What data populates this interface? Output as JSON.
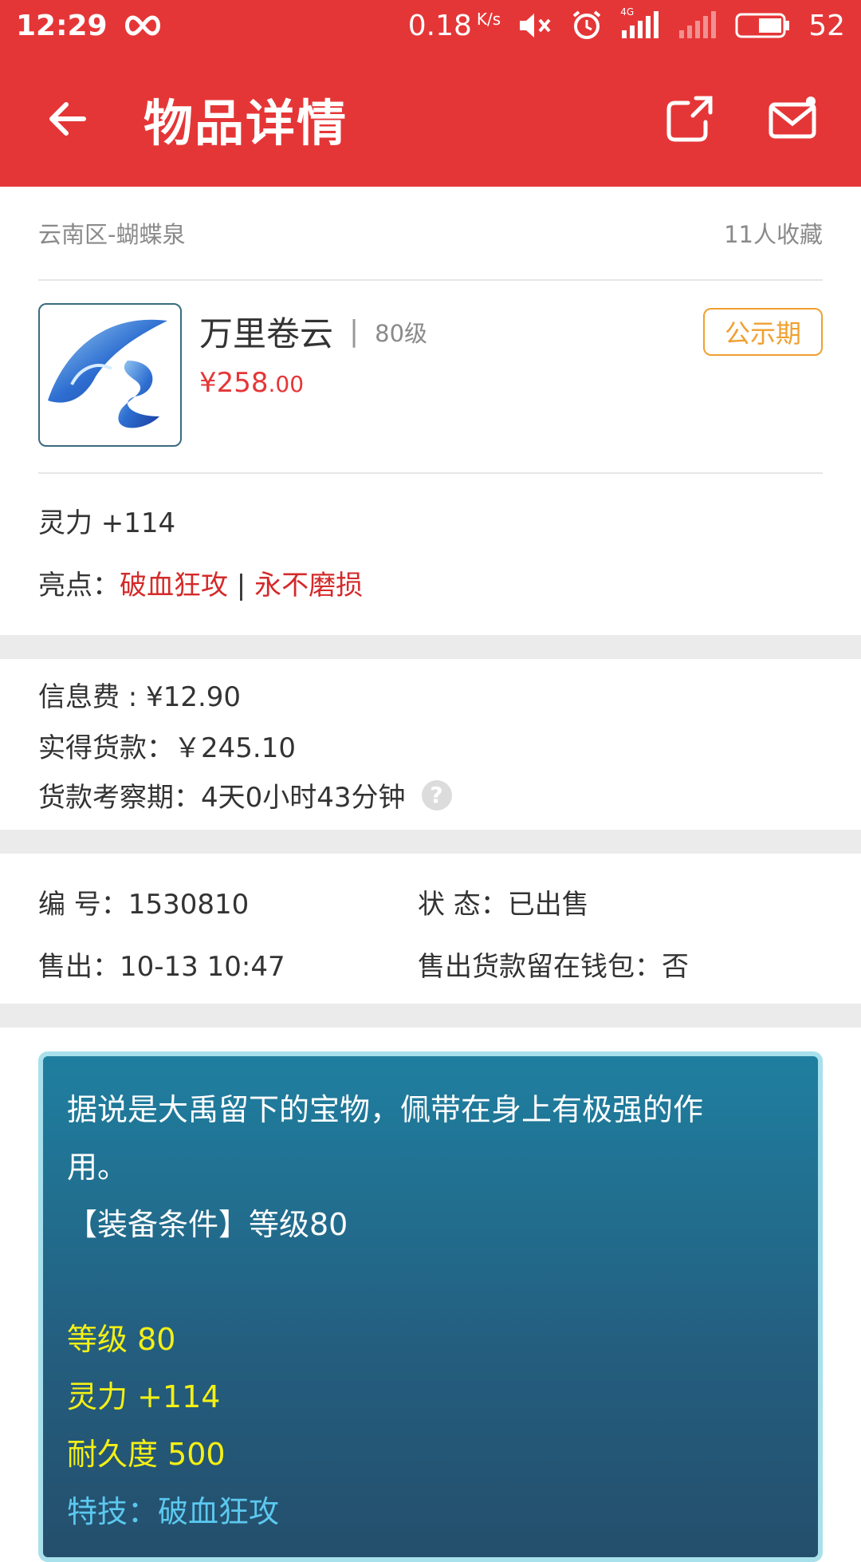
{
  "status_bar": {
    "time": "12:29",
    "speed": "0.18",
    "speed_unit": "K/s",
    "network": "4G",
    "battery": "52"
  },
  "header": {
    "title": "物品详情"
  },
  "item": {
    "location": "云南区-蝴蝶泉",
    "favorites": "11人收藏",
    "name": "万里卷云",
    "separator": "|",
    "level": "80级",
    "price_main": "¥258",
    "price_cents": ".00",
    "badge": "公示期",
    "attribute": "灵力 +114",
    "highlights_label": "亮点：",
    "highlight_1": "破血狂攻",
    "highlight_sep": " | ",
    "highlight_2": "永不磨损"
  },
  "fees": {
    "info_fee": "信息费 : ¥12.90",
    "actual_payment": "实得货款：￥245.10",
    "review_period": "货款考察期：4天0小时43分钟",
    "help_symbol": "?"
  },
  "meta": {
    "id": "编  号：1530810",
    "status": "状  态：已出售",
    "sold_time": "售出：10-13 10:47",
    "wallet": "售出货款留在钱包：否"
  },
  "description": {
    "line1": "据说是大禹留下的宝物，佩带在身上有极强的作",
    "line2": "用。",
    "line3": "【装备条件】等级80",
    "stat_level": "等级 80",
    "stat_spirit": "灵力 +114",
    "stat_durability": "耐久度 500",
    "skill": "特技：破血狂攻"
  },
  "colors": {
    "brand_red": "#e53637",
    "badge_orange": "#f0a030",
    "highlight_red": "#d42a2a",
    "desc_yellow": "#f4f015",
    "desc_cyan": "#5cc8ef"
  }
}
